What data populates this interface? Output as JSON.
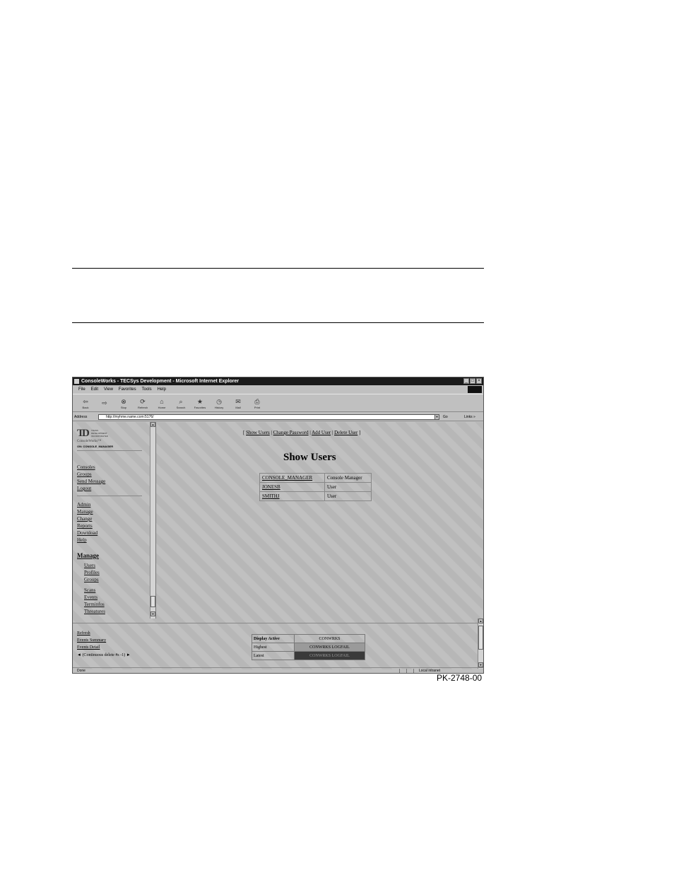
{
  "browser": {
    "title": "ConsoleWorks - TECSys Development - Microsoft Internet Explorer",
    "window_controls": [
      "_",
      "□",
      "×"
    ],
    "menu": [
      "File",
      "Edit",
      "View",
      "Favorites",
      "Tools",
      "Help"
    ],
    "toolbar": [
      {
        "label": "Back",
        "icon": "back-arrow-icon",
        "glyph": "⇦"
      },
      {
        "label": "",
        "icon": "forward-arrow-icon",
        "glyph": "⇨"
      },
      {
        "label": "Stop",
        "icon": "stop-icon",
        "glyph": "⊗"
      },
      {
        "label": "Refresh",
        "icon": "refresh-icon",
        "glyph": "⟳"
      },
      {
        "label": "Home",
        "icon": "home-icon",
        "glyph": "⌂"
      },
      {
        "label": "Search",
        "icon": "search-icon",
        "glyph": "⌕"
      },
      {
        "label": "Favorites",
        "icon": "favorites-icon",
        "glyph": "★"
      },
      {
        "label": "History",
        "icon": "history-icon",
        "glyph": "◷"
      },
      {
        "label": "Mail",
        "icon": "mail-icon",
        "glyph": "✉"
      },
      {
        "label": "Print",
        "icon": "print-icon",
        "glyph": "⎙"
      }
    ],
    "address_label": "Address",
    "address_value": "http://myhme.name.com:5176/",
    "go_label": "Go",
    "links_label": "Links »"
  },
  "sidebar": {
    "company_lines": [
      "TRANS",
      "DEVELOPMENT",
      "INCORPORATED"
    ],
    "brand": "ConsoleWorks™",
    "user_line": "ON: CONSOLE_MANAGER",
    "group1": [
      "Consoles",
      "Groups",
      "Send Message",
      "Logout"
    ],
    "group2": [
      "Admin",
      "Manage",
      "Change",
      "Reports",
      "Download",
      "Help"
    ],
    "manage_heading": "Manage",
    "manage_items": [
      "Users",
      "Profiles",
      "Groups"
    ],
    "manage_items2": [
      "Scans",
      "Events",
      "Terminfos",
      "Threatures"
    ]
  },
  "main": {
    "nav": [
      "Show Users",
      "Change Password",
      "Add User",
      "Delete User"
    ],
    "title": "Show Users",
    "users": [
      {
        "name": "CONSOLE_MANAGER",
        "role": "Console Manager"
      },
      {
        "name": "JONESB",
        "role": "User"
      },
      {
        "name": "SMITHJ",
        "role": "User"
      }
    ]
  },
  "lower": {
    "links": [
      "Refresh",
      "Events Summary",
      "Events Detail"
    ],
    "continuous": "◄ (Continuous delete #s -1) ►",
    "events_header_label": "Display Active",
    "events_header_value": "CONWRKS",
    "rows": [
      {
        "label": "Highest",
        "value": "CONWRKS LOGFAIL"
      },
      {
        "label": "Latest",
        "value": "CONWRKS LOGFAIL"
      }
    ]
  },
  "status": {
    "text": "Done",
    "zone": "Local intranet"
  },
  "figure_id": "PK-2748-00"
}
